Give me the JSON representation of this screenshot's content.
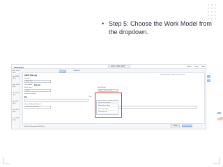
{
  "instruction": {
    "bullet": "•",
    "text": "Step 5: Choose the Work Model from the dropdown."
  },
  "app": {
    "title": "Timesheet",
    "date_range": "12/01 - 12/31, 2024",
    "actions": [
      "Submit",
      "Save",
      "More"
    ]
  },
  "sidebar": {
    "items": [
      {
        "label": "Mon, 12/02",
        "hours": "08:00",
        "active": false
      },
      {
        "label": "Tue, 12/03",
        "hours": "08:00",
        "active": true
      },
      {
        "label": "Wed, 12/04",
        "hours": "08:00",
        "active": false
      },
      {
        "label": "Thu, 12/05",
        "hours": "08:00",
        "active": false
      },
      {
        "label": "Fri, 12/06",
        "hours": "08:00",
        "active": false
      },
      {
        "label": "Sat, 12/07",
        "hours": "08:00",
        "active": false
      },
      {
        "label": "Sun, 12/08",
        "hours": "08:00",
        "active": false
      }
    ]
  },
  "tabs": [
    "Time Log",
    "Absence"
  ],
  "form": {
    "section_title": "ABCS Time Log",
    "link_right": "View Work Hours Status for this week",
    "project_label": "Project *",
    "project_value": "ABCS Ltd",
    "phase_label": "Phase/ABS:",
    "phase_value": "Internal",
    "work_type_label": "Work Type *",
    "work_type_value": "Work",
    "work_model_label": "Work Model *",
    "work_model_placeholder": "Please select model",
    "description_label": "Work Description",
    "description_value": "P1",
    "task_label": "Task",
    "hours_label": "Hours Worked (HH:mm) *",
    "hours_value": "Enter hours (hh:mm)"
  },
  "dropdown": {
    "items": [
      "Please select model",
      "Remote From Home",
      "Work From Office",
      "Client Site Visit"
    ]
  },
  "footer": {
    "text": "Total Time Recorded: 08:00 hrs",
    "cancel": "Cancel",
    "save": "Save & Close"
  },
  "colors": {
    "accent": "#3a66a8",
    "highlight_box": "#dd3333",
    "side_blue": "#9ec3ea",
    "side_red": "#f0c6c0"
  }
}
